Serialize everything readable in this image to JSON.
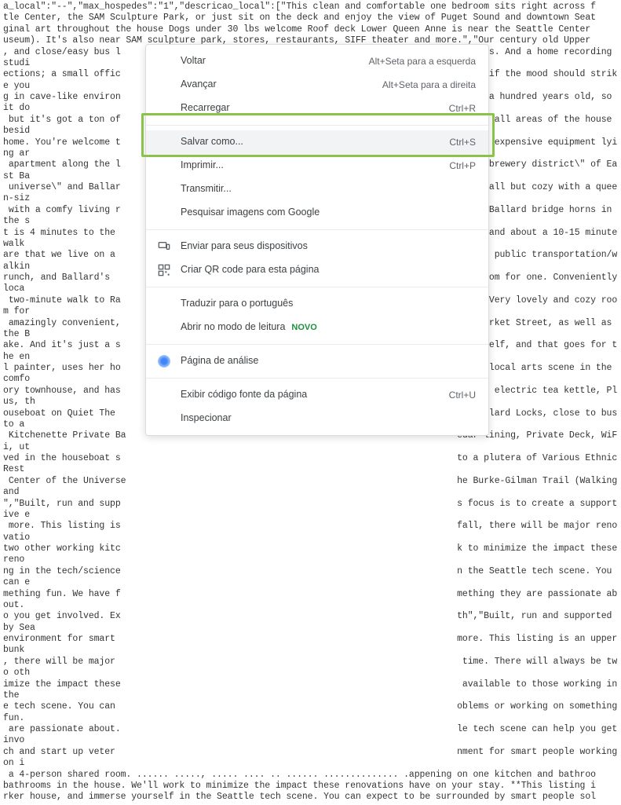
{
  "background_text": "a_local\":\"--\",\"max_hospedes\":\"1\",\"descricao_local\":[\"This clean and comfortable one bedroom sits right across f\ntle Center, the SAM Sculpture Park, or just sit on the deck and enjoy the view of Puget Sound and downtown Seat\nginal art throughout the house Dogs under 30 lbs welcome Roof deck Lower Queen Anne is near the Seattle Center\nuseum). It's also near SAM sculpture park, stores, restaurants, SIFF theater and more.\",\"Our century old Upper\n, and close/easy bus l                                                               ommates. And a home recording studi\nections; a small offic                                                               itar, if the mood should strike you\ng in cave-like environ                                                                over a hundred years old, so it do\n but it's got a ton of                                                               access all areas of the house besid\nhome. You're welcome t                                                               unt of expensive equipment lying ar\n apartment along the l                                                               the \\\"brewery district\\\" of East Ba\n universe\\\" and Ballar                                                                is small but cozy with a queen-siz\n with a comfy living r                                                               o the Ballard bridge horns in the s\nt is 4 minutes to the                                                                trict and about a 10-15 minute walk\nare that we live on a                                                                 using public transportation/walkin\nrunch, and Ballard's                                                                 ozy room for one. Conveniently loca\n two-minute walk to Ra                                                               ttle. Very lovely and cozy room for\n amazingly convenient,                                                                on Market Street, as well as the B\nake. And it's just a s                                                               om itself, and that goes for the en\nl painter, uses her ho                                                               h the local arts scene in the comfo\nory townhouse, and has                                                               oven,  electric tea kettle, Plus, th\nouseboat on Quiet The                                                                he Ballard Locks, close to bus to a\n Kitchenette Private Ba                                                              edar lining, Private Deck, WiFi, ut\nved in the houseboat s                                                               to a plutera of Various Ethnic Rest\n Center of the Universe                                                              he Burke-Gilman Trail (Walking and\n\",\"Built, run and supp                                                               s focus is to create a supportive e\n more. This listing is                                                               fall, there will be major renovatio\ntwo other working kitc                                                               k to minimize the impact these reno\nng in the tech/science                                                               n the Seattle tech scene. You can e\nmething fun. We have f                                                               mething they are passionate about.\no you get involved. Ex                                                               th\",\"Built, run and supported by Sea\nenvironment for smart                                                                more. This listing is an upper bunk\n, there will be major                                                                 time. There will always be two oth\nimize the impact these                                                                available to those working in the\ne tech scene. You can                                                                oblems or working on something fun.\n are passionate about.                                                               le tech scene can help you get invo\nch and start up veter                                                                nment for smart people working on i\n a 4-person shared room. ...... ....., ..... .... .. ...... .............. .appening on one kitchen and bathroo\nbathrooms in the house. We'll work to minimize the impact these renovations have on your stay. **This listing i\nrker house, and immerse yourself in the Seattle tech scene. You can expect to be surrounded by smart people sol",
  "menu": {
    "back": {
      "label": "Voltar",
      "shortcut": "Alt+Seta para a esquerda"
    },
    "forward": {
      "label": "Avançar",
      "shortcut": "Alt+Seta para a direita"
    },
    "reload": {
      "label": "Recarregar",
      "shortcut": "Ctrl+R"
    },
    "saveas": {
      "label": "Salvar como...",
      "shortcut": "Ctrl+S"
    },
    "print": {
      "label": "Imprimir...",
      "shortcut": "Ctrl+P"
    },
    "cast": {
      "label": "Transmitir..."
    },
    "searchimg": {
      "label": "Pesquisar imagens com Google"
    },
    "sendto": {
      "label": "Enviar para seus dispositivos"
    },
    "qrcode": {
      "label": "Criar QR code para esta página"
    },
    "translate": {
      "label": "Traduzir para o português"
    },
    "reader": {
      "label": "Abrir no modo de leitura",
      "badge": "NOVO"
    },
    "analysis": {
      "label": "Página de análise"
    },
    "viewsource": {
      "label": "Exibir código fonte da página",
      "shortcut": "Ctrl+U"
    },
    "inspect": {
      "label": "Inspecionar"
    }
  }
}
